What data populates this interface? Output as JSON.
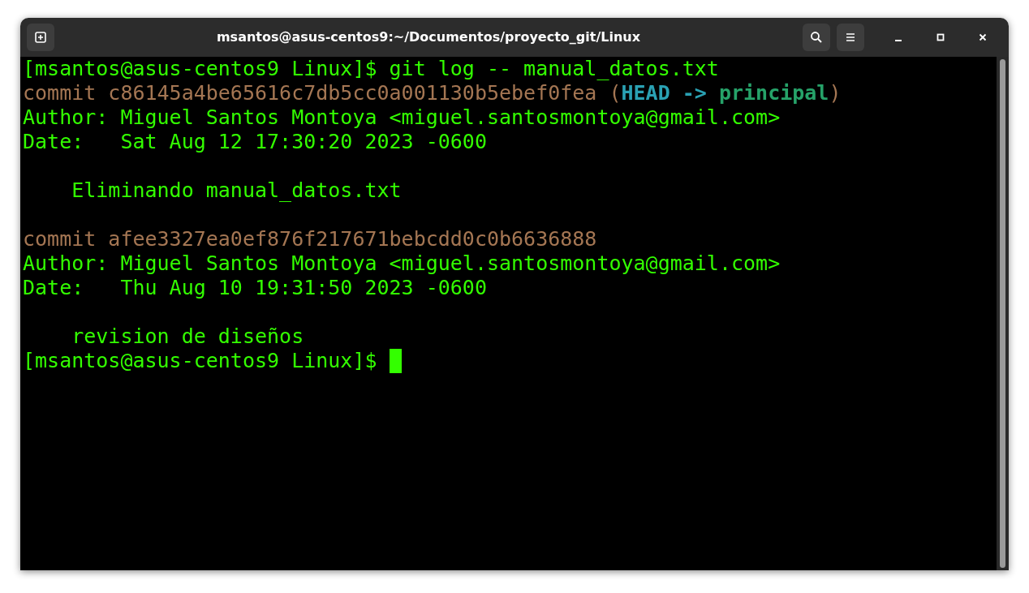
{
  "window": {
    "title": "msantos@asus-centos9:~/Documentos/proyecto_git/Linux"
  },
  "lines": [
    {
      "kind": "text",
      "segments": [
        {
          "kind": "plain",
          "text": "[msantos@asus-centos9 Linux]$ git log -- manual_datos.txt"
        }
      ]
    },
    {
      "kind": "text",
      "segments": [
        {
          "kind": "commit",
          "text": "commit c86145a4be65616c7db5cc0a001130b5ebef0fea ("
        },
        {
          "kind": "head",
          "text": "HEAD -> "
        },
        {
          "kind": "branch",
          "text": "principal"
        },
        {
          "kind": "commit",
          "text": ")"
        }
      ]
    },
    {
      "kind": "text",
      "segments": [
        {
          "kind": "plain",
          "text": "Author: Miguel Santos Montoya <miguel.santosmontoya@gmail.com>"
        }
      ]
    },
    {
      "kind": "text",
      "segments": [
        {
          "kind": "plain",
          "text": "Date:   Sat Aug 12 17:30:20 2023 -0600"
        }
      ]
    },
    {
      "kind": "blank"
    },
    {
      "kind": "text",
      "segments": [
        {
          "kind": "plain",
          "text": "    Eliminando manual_datos.txt"
        }
      ]
    },
    {
      "kind": "blank"
    },
    {
      "kind": "text",
      "segments": [
        {
          "kind": "commit",
          "text": "commit afee3327ea0ef876f217671bebcdd0c0b6636888"
        }
      ]
    },
    {
      "kind": "text",
      "segments": [
        {
          "kind": "plain",
          "text": "Author: Miguel Santos Montoya <miguel.santosmontoya@gmail.com>"
        }
      ]
    },
    {
      "kind": "text",
      "segments": [
        {
          "kind": "plain",
          "text": "Date:   Thu Aug 10 19:31:50 2023 -0600"
        }
      ]
    },
    {
      "kind": "blank"
    },
    {
      "kind": "text",
      "segments": [
        {
          "kind": "plain",
          "text": "    revision de diseños"
        }
      ]
    },
    {
      "kind": "text",
      "cursor": true,
      "segments": [
        {
          "kind": "plain",
          "text": "[msantos@asus-centos9 Linux]$ "
        }
      ]
    }
  ]
}
